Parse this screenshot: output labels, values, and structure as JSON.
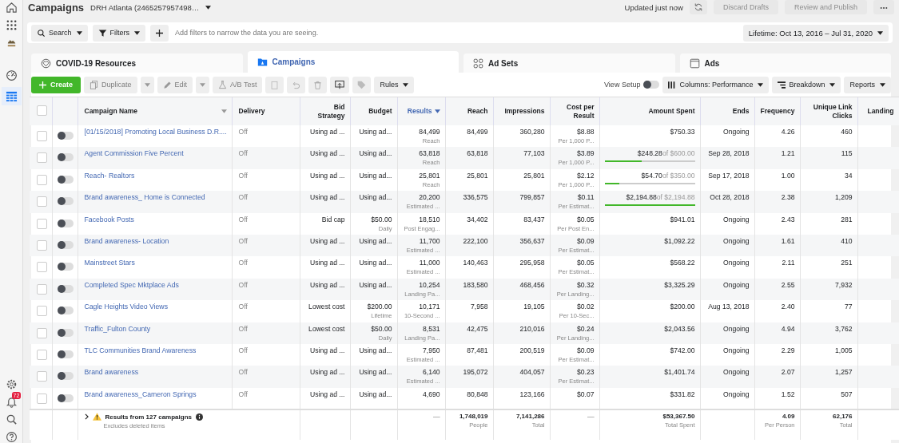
{
  "header": {
    "title": "Campaigns",
    "account": "DRH Atlanta (2465257957498…",
    "status": "Updated just now",
    "actions": [
      {
        "label": "Discard Drafts",
        "disabled": true
      },
      {
        "label": "Review and Publish",
        "disabled": true
      }
    ]
  },
  "sidebar": {
    "badge": "72"
  },
  "filter_bar": {
    "buttons": [
      "Search",
      "Filters"
    ],
    "placeholder": "Add filters to narrow the data you are seeing.",
    "date_range": "Lifetime: Oct 13, 2016 – Jul 31, 2020"
  },
  "tabs": [
    {
      "label": "COVID-19 Resources",
      "selected": false
    },
    {
      "label": "Campaigns",
      "selected": true
    },
    {
      "label": "Ad Sets",
      "selected": false
    },
    {
      "label": "Ads",
      "selected": false
    }
  ],
  "toolbar": {
    "create": "Create",
    "actions": [
      {
        "label": "Duplicate",
        "disabled": true
      },
      {
        "label": "Edit",
        "disabled": true
      },
      {
        "label": "A/B Test",
        "disabled": true
      }
    ],
    "rules": "Rules",
    "view_setup": {
      "label": "View Setup",
      "on": false
    },
    "menus": [
      "Columns: Performance",
      "Breakdown",
      "Reports"
    ]
  },
  "table": {
    "select_all": {
      "checked": false
    },
    "columns": [
      {
        "label": "Campaign Name",
        "sorted": false
      },
      {
        "label": "Delivery",
        "sorted": false
      },
      {
        "label": "Bid Strategy",
        "sorted": false
      },
      {
        "label": "Budget",
        "sorted": false
      },
      {
        "label": "Results",
        "sorted": true
      },
      {
        "label": "Reach",
        "sorted": false
      },
      {
        "label": "Impressions",
        "sorted": false
      },
      {
        "label": "Cost per Result",
        "sorted": false
      },
      {
        "label": "Amount Spent",
        "sorted": false
      },
      {
        "label": "Ends",
        "sorted": false
      },
      {
        "label": "Frequency",
        "sorted": false
      },
      {
        "label": "Unique Link Clicks",
        "sorted": false
      },
      {
        "label": "Landing",
        "sorted": false
      }
    ],
    "rows": [
      {
        "checked": false,
        "on": false,
        "name": "[01/15/2018] Promoting Local Business D.R....",
        "delivery": "Off",
        "bid": "Using ad ...",
        "budget": "Using ad...",
        "results": "84,499",
        "results_label": "Reach",
        "reach": "84,499",
        "impressions": "360,280",
        "cost": "$8.88",
        "cost_label": "Per 1,000 P...",
        "amount": "$750.33",
        "ends": "Ongoing",
        "frequency": "4.26",
        "clicks": "460"
      },
      {
        "checked": false,
        "on": false,
        "name": "Agent Commission Five Percent",
        "delivery": "Off",
        "bid": "Using ad ...",
        "budget": "Using ad...",
        "results": "63,818",
        "results_label": "Reach",
        "reach": "63,818",
        "impressions": "77,103",
        "cost": "$3.89",
        "cost_label": "Per 1,000 P...",
        "amount": "$248.28",
        "amount_limit": "of $600.00",
        "level": 0.41,
        "ends": "Sep 28, 2018",
        "frequency": "1.21",
        "clicks": "115"
      },
      {
        "checked": false,
        "on": false,
        "name": "Reach- Realtors",
        "delivery": "Off",
        "bid": "Using ad ...",
        "budget": "Using ad...",
        "results": "25,801",
        "results_label": "Reach",
        "reach": "25,801",
        "impressions": "25,801",
        "cost": "$2.12",
        "cost_label": "Per 1,000 P...",
        "amount": "$54.70",
        "amount_limit": "of $350.00",
        "level": 0.16,
        "ends": "Sep 17, 2018",
        "frequency": "1.00",
        "clicks": "34"
      },
      {
        "checked": false,
        "on": false,
        "name": "Brand awareness_ Home is Connected",
        "delivery": "Off",
        "bid": "Using ad ...",
        "budget": "Using ad...",
        "results": "20,200",
        "results_label": "Estimated ...",
        "reach": "336,575",
        "impressions": "799,857",
        "cost": "$0.11",
        "cost_label": "Per Estimat...",
        "amount": "$2,194.88",
        "amount_limit": "of $2,194.88",
        "level": 1,
        "ends": "Oct 28, 2018",
        "frequency": "2.38",
        "clicks": "1,209"
      },
      {
        "checked": false,
        "on": false,
        "name": "Facebook Posts",
        "delivery": "Off",
        "bid": "Bid cap",
        "budget": "$50.00",
        "budget_label": "Daily",
        "results": "18,510",
        "results_label": "Post Engag...",
        "reach": "34,402",
        "impressions": "83,437",
        "cost": "$0.05",
        "cost_label": "Per Post En...",
        "amount": "$941.01",
        "ends": "Ongoing",
        "frequency": "2.43",
        "clicks": "281"
      },
      {
        "checked": false,
        "on": false,
        "name": "Brand awareness- Location",
        "delivery": "Off",
        "bid": "Using ad ...",
        "budget": "Using ad...",
        "results": "11,700",
        "results_label": "Estimated ...",
        "reach": "222,100",
        "impressions": "356,637",
        "cost": "$0.09",
        "cost_label": "Per Estimat...",
        "amount": "$1,092.22",
        "ends": "Ongoing",
        "frequency": "1.61",
        "clicks": "410"
      },
      {
        "checked": false,
        "on": false,
        "name": "Mainstreet Stars",
        "delivery": "Off",
        "bid": "Using ad ...",
        "budget": "Using ad...",
        "results": "11,000",
        "results_label": "Estimated ...",
        "reach": "140,463",
        "impressions": "295,958",
        "cost": "$0.05",
        "cost_label": "Per Estimat...",
        "amount": "$568.22",
        "ends": "Ongoing",
        "frequency": "2.11",
        "clicks": "251"
      },
      {
        "checked": false,
        "on": false,
        "name": "Completed Spec Mktplace Ads",
        "delivery": "Off",
        "bid": "Using ad ...",
        "budget": "Using ad...",
        "results": "10,254",
        "results_label": "Landing Pa...",
        "reach": "183,580",
        "impressions": "468,456",
        "cost": "$0.32",
        "cost_label": "Per Landing...",
        "amount": "$3,325.29",
        "ends": "Ongoing",
        "frequency": "2.55",
        "clicks": "7,932"
      },
      {
        "checked": false,
        "on": false,
        "name": "Cagle Heights Video Views",
        "delivery": "Off",
        "bid": "Lowest cost",
        "budget": "$200.00",
        "budget_label": "Lifetime",
        "results": "10,171",
        "results_label": "10-Second ...",
        "reach": "7,958",
        "impressions": "19,105",
        "cost": "$0.02",
        "cost_label": "Per 10-Sec...",
        "amount": "$200.00",
        "ends": "Aug 13, 2018",
        "frequency": "2.40",
        "clicks": "77"
      },
      {
        "checked": false,
        "on": false,
        "name": "Traffic_Fulton County",
        "delivery": "Off",
        "bid": "Lowest cost",
        "budget": "$50.00",
        "budget_label": "Daily",
        "results": "8,531",
        "results_label": "Landing Pa...",
        "reach": "42,475",
        "impressions": "210,016",
        "cost": "$0.24",
        "cost_label": "Per Landing...",
        "amount": "$2,043.56",
        "ends": "Ongoing",
        "frequency": "4.94",
        "clicks": "3,762"
      },
      {
        "checked": false,
        "on": false,
        "name": "TLC Communities Brand Awareness",
        "delivery": "Off",
        "bid": "Using ad ...",
        "budget": "Using ad...",
        "results": "7,950",
        "results_label": "Estimated ...",
        "reach": "87,481",
        "impressions": "200,519",
        "cost": "$0.09",
        "cost_label": "Per Estimat...",
        "amount": "$742.00",
        "ends": "Ongoing",
        "frequency": "2.29",
        "clicks": "1,005"
      },
      {
        "checked": false,
        "on": false,
        "name": "Brand awareness",
        "delivery": "Off",
        "bid": "Using ad ...",
        "budget": "Using ad...",
        "results": "6,140",
        "results_label": "Estimated ...",
        "reach": "195,072",
        "impressions": "404,057",
        "cost": "$0.23",
        "cost_label": "Per Estimat...",
        "amount": "$1,401.74",
        "ends": "Ongoing",
        "frequency": "2.07",
        "clicks": "1,257"
      },
      {
        "checked": false,
        "on": false,
        "name": "Brand awareness_Cameron Springs",
        "delivery": "Off",
        "bid": "Using ad ...",
        "budget": "Using ad...",
        "results": "4,690",
        "reach": "80,848",
        "impressions": "123,166",
        "cost": "$0.07",
        "amount": "$331.82",
        "ends": "Ongoing",
        "frequency": "1.52",
        "clicks": "507"
      }
    ],
    "summary": {
      "title": "Results from 127 campaigns",
      "note": "Excludes deleted items",
      "results": "—",
      "reach": "1,748,019",
      "reach_label": "People",
      "impressions": "7,141,286",
      "impressions_label": "Total",
      "cost": "—",
      "amount": "$53,367.50",
      "amount_label": "Total Spent",
      "frequency": "4.09",
      "frequency_label": "Per Person",
      "clicks": "62,176",
      "clicks_label": "Total"
    }
  }
}
